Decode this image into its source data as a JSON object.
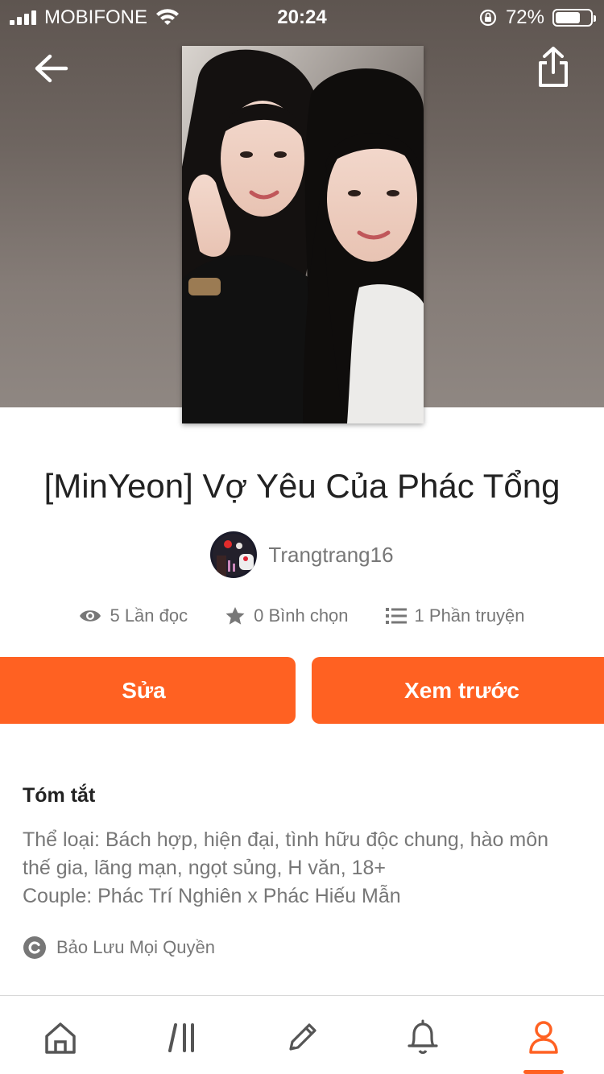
{
  "status_bar": {
    "carrier": "MOBIFONE",
    "time": "20:24",
    "battery_percent": "72%",
    "battery_level": 0.72
  },
  "header": {
    "back_icon": "arrow-left-icon",
    "share_icon": "share-icon"
  },
  "story": {
    "title": "[MinYeon] Vợ Yêu Của Phác Tổng",
    "author": "Trangtrang16",
    "stats": {
      "reads": "5 Lần đọc",
      "votes": "0 Bình chọn",
      "parts": "1 Phần truyện"
    }
  },
  "actions": {
    "edit_label": "Sửa",
    "preview_label": "Xem trước"
  },
  "summary": {
    "heading": "Tóm tắt",
    "text": "Thể loại: Bách hợp, hiện đại, tình hữu độc chung, hào môn\nthế gia, lãng mạn, ngọt sủng, H văn, 18+\nCouple: Phác Trí Nghiên x Phác Hiếu Mẫn",
    "copyright": "Bảo Lưu Mọi Quyền"
  },
  "tabbar": {
    "tabs": [
      "home-icon",
      "library-icon",
      "write-icon",
      "notifications-icon",
      "profile-icon"
    ],
    "active": "profile-icon"
  },
  "colors": {
    "accent": "#ff6122",
    "muted_text": "#777777"
  }
}
